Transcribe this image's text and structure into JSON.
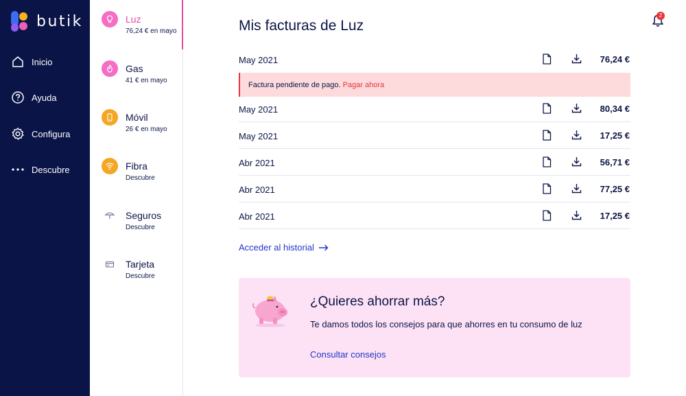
{
  "brand": {
    "name": "butik"
  },
  "nav": {
    "items": [
      {
        "label": "Inicio",
        "icon": "home-icon"
      },
      {
        "label": "Ayuda",
        "icon": "help-icon"
      },
      {
        "label": "Configura",
        "icon": "gear-icon"
      },
      {
        "label": "Descubre",
        "icon": "more-dots-icon"
      }
    ]
  },
  "services": [
    {
      "name": "Luz",
      "sub": "76,24 € en mayo",
      "icon": "lightbulb-icon",
      "active": true
    },
    {
      "name": "Gas",
      "sub": "41 € en mayo",
      "icon": "flame-icon"
    },
    {
      "name": "Móvil",
      "sub": "26 € en mayo",
      "icon": "phone-icon"
    },
    {
      "name": "Fibra",
      "sub": "Descubre",
      "icon": "wifi-icon"
    },
    {
      "name": "Seguros",
      "sub": "Descubre",
      "icon": "umbrella-icon"
    },
    {
      "name": "Tarjeta",
      "sub": "Descubre",
      "icon": "card-icon"
    }
  ],
  "header": {
    "title": "Mis facturas de Luz",
    "notifications": "2"
  },
  "invoices": [
    {
      "date": "May 2021",
      "amount": "76,24 €"
    },
    {
      "date": "May 2021",
      "amount": "80,34 €"
    },
    {
      "date": "May 2021",
      "amount": "17,25 €"
    },
    {
      "date": "Abr 2021",
      "amount": "56,71 €"
    },
    {
      "date": "Abr 2021",
      "amount": "77,25 €"
    },
    {
      "date": "Abr 2021",
      "amount": "17,25 €"
    }
  ],
  "alert": {
    "message": "Factura pendiente de pago.",
    "action": "Pagar ahora"
  },
  "history_link": "Acceder al historial",
  "promo": {
    "title": "¿Quieres ahorrar más?",
    "text": "Te damos todos los consejos para que ahorres en tu consumo de luz",
    "link": "Consultar consejos"
  },
  "colors": {
    "nav_bg": "#0b1447",
    "accent_pink": "#e44ba4",
    "link_blue": "#2236c7",
    "alert_red": "#e8343c",
    "alert_bg": "#fddbdd",
    "promo_bg": "#fde2f5"
  }
}
